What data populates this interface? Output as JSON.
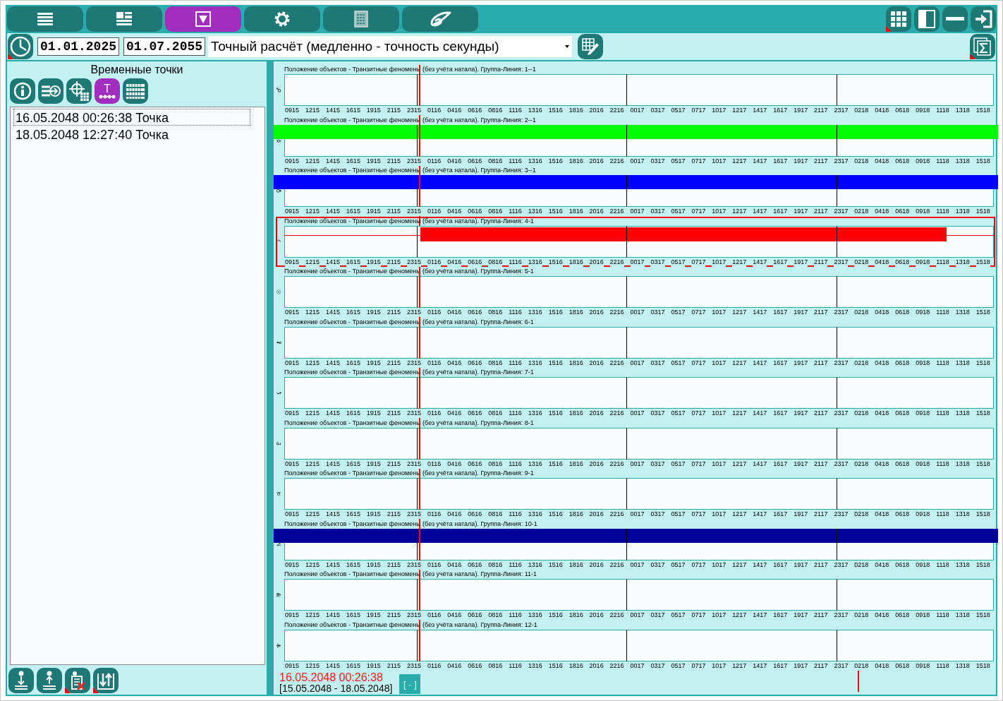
{
  "toolbar": {
    "tabs": [
      {
        "selected": false
      },
      {
        "selected": false
      },
      {
        "selected": true
      },
      {
        "selected": false
      },
      {
        "selected": false
      },
      {
        "selected": false
      }
    ],
    "window_buttons": [
      {
        "marked": true
      },
      {
        "marked": false
      },
      {
        "marked": false
      },
      {
        "marked": false
      }
    ]
  },
  "range_bar": {
    "clock_marked": true,
    "date_from": "01.01.2025",
    "date_to": "01.07.2055",
    "mode": "Точный расчёт (медленно - точность секунды)",
    "sum_marked": true
  },
  "time_points": {
    "title": "Временные точки",
    "tools": [
      {
        "selected": false
      },
      {
        "selected": false
      },
      {
        "selected": false
      },
      {
        "selected": true,
        "label": "T"
      },
      {
        "selected": false
      }
    ],
    "items": [
      {
        "text": "16.05.2048 00:26:38 Точка",
        "selected": true
      },
      {
        "text": "18.05.2048 12:27:40 Точка",
        "selected": false
      }
    ],
    "bottom_tools": [
      {
        "marked": false
      },
      {
        "marked": false
      },
      {
        "marked": true
      },
      {
        "marked": true
      }
    ]
  },
  "tracks": [
    {
      "title": "Положение объектов - Транзитные феномены (без учёта натала). Группа-Линия: 1--1",
      "symbol": "♂",
      "selected": false,
      "ticks": [
        "0915",
        "1215",
        "1415",
        "1615",
        "1915",
        "2115",
        "2315",
        "0116",
        "0416",
        "0616",
        "0816",
        "1116",
        "1316",
        "1516",
        "1816",
        "2016",
        "2216",
        "0017",
        "0317",
        "0517",
        "0717",
        "1017",
        "1217",
        "1417",
        "1617",
        "1917",
        "2117",
        "2317",
        "0218",
        "0418",
        "0618",
        "0918",
        "1118",
        "1318",
        "1518"
      ]
    },
    {
      "title": "Положение объектов - Транзитные феномены (без учёта натала). Группа-Линия: 2--1",
      "symbol": "☿",
      "selected": false,
      "band": {
        "color": "#00ff00",
        "kind": "full"
      },
      "ticks": [
        "0915",
        "1215",
        "1415",
        "1615",
        "1915",
        "2115",
        "2315",
        "0116",
        "0416",
        "0616",
        "0816",
        "1116",
        "1316",
        "1516",
        "1816",
        "2016",
        "2216",
        "0017",
        "0317",
        "0517",
        "0717",
        "1017",
        "1217",
        "1417",
        "1617",
        "1917",
        "2117",
        "2317",
        "0218",
        "0418",
        "0618",
        "0918",
        "1118",
        "1318",
        "1518"
      ]
    },
    {
      "title": "Положение объектов - Транзитные феномены (без учёта натала). Группа-Линия: 3--1",
      "symbol": "♀",
      "selected": false,
      "band": {
        "color": "#0000ff",
        "kind": "full"
      },
      "ticks": [
        "0915",
        "1215",
        "1415",
        "1615",
        "1915",
        "2115",
        "2315",
        "0116",
        "0416",
        "0616",
        "0816",
        "1116",
        "1316",
        "1516",
        "1816",
        "2016",
        "2216",
        "0017",
        "0317",
        "0517",
        "0717",
        "1017",
        "1217",
        "1417",
        "1617",
        "1917",
        "2117",
        "2317",
        "0218",
        "0418",
        "0618",
        "0918",
        "1118",
        "1318",
        "1518"
      ]
    },
    {
      "title": "Положение объектов - Транзитные феномены (без учёта натала). Группа-Линия: 4-1",
      "symbol": "☽",
      "selected": true,
      "band": {
        "color": "#ff0000",
        "kind": "partial"
      },
      "ticks": [
        "0915",
        "1215",
        "1415",
        "1615",
        "1915",
        "2115",
        "2315",
        "0116",
        "0416",
        "0616",
        "0816",
        "1116",
        "1316",
        "1516",
        "1816",
        "2016",
        "2216",
        "0017",
        "0317",
        "0517",
        "0717",
        "1017",
        "1217",
        "1417",
        "1617",
        "1917",
        "2117",
        "2317",
        "0218",
        "0418",
        "0618",
        "0918",
        "1118",
        "1318",
        "1518"
      ]
    },
    {
      "title": "Положение объектов - Транзитные феномены (без учёта натала). Группа-Линия: 5-1",
      "symbol": "☉",
      "selected": false,
      "ticks": [
        "0915",
        "1215",
        "1415",
        "1615",
        "1915",
        "2115",
        "2315",
        "0116",
        "0416",
        "0616",
        "0816",
        "1116",
        "1316",
        "1516",
        "1816",
        "2016",
        "2216",
        "0017",
        "0317",
        "0517",
        "0717",
        "1017",
        "1217",
        "1417",
        "1617",
        "1917",
        "2117",
        "2317",
        "0218",
        "0418",
        "0618",
        "0918",
        "1118",
        "1318",
        "1518"
      ]
    },
    {
      "title": "Положение объектов - Транзитные феномены (без учёта натала). Группа-Линия: 6-1",
      "symbol": "⚷",
      "selected": false,
      "ticks": [
        "0915",
        "1215",
        "1415",
        "1615",
        "1915",
        "2115",
        "2315",
        "0116",
        "0416",
        "0616",
        "0816",
        "1116",
        "1316",
        "1516",
        "1816",
        "2016",
        "2216",
        "0017",
        "0317",
        "0517",
        "0717",
        "1017",
        "1217",
        "1417",
        "1617",
        "1917",
        "2117",
        "2317",
        "0218",
        "0418",
        "0618",
        "0918",
        "1118",
        "1318",
        "1518"
      ]
    },
    {
      "title": "Положение объектов - Транзитные феномены (без учёта натала). Группа-Линия: 7-1",
      "symbol": "⚸",
      "selected": false,
      "ticks": [
        "0915",
        "1215",
        "1415",
        "1615",
        "1915",
        "2115",
        "2315",
        "0116",
        "0416",
        "0616",
        "0816",
        "1116",
        "1316",
        "1516",
        "1816",
        "2016",
        "2216",
        "0017",
        "0317",
        "0517",
        "0717",
        "1017",
        "1217",
        "1417",
        "1617",
        "1917",
        "2117",
        "2317",
        "0218",
        "0418",
        "0618",
        "0918",
        "1118",
        "1318",
        "1518"
      ]
    },
    {
      "title": "Положение объектов - Транзитные феномены (без учёта натала). Группа-Линия: 8-1",
      "symbol": "♇",
      "selected": false,
      "ticks": [
        "0915",
        "1215",
        "1415",
        "1615",
        "1915",
        "2115",
        "2315",
        "0116",
        "0416",
        "0616",
        "0816",
        "1116",
        "1316",
        "1516",
        "1816",
        "2016",
        "2216",
        "0017",
        "0317",
        "0517",
        "0717",
        "1017",
        "1217",
        "1417",
        "1617",
        "1917",
        "2117",
        "2317",
        "0218",
        "0418",
        "0618",
        "0918",
        "1118",
        "1318",
        "1518"
      ]
    },
    {
      "title": "Положение объектов - Транзитные феномены (без учёта натала). Группа-Линия: 9-1",
      "symbol": "♃",
      "selected": false,
      "ticks": [
        "0915",
        "1215",
        "1415",
        "1615",
        "1915",
        "2115",
        "2315",
        "0116",
        "0416",
        "0616",
        "0816",
        "1116",
        "1316",
        "1516",
        "1816",
        "2016",
        "2216",
        "0017",
        "0317",
        "0517",
        "0717",
        "1017",
        "1217",
        "1417",
        "1617",
        "1917",
        "2117",
        "2317",
        "0218",
        "0418",
        "0618",
        "0918",
        "1118",
        "1318",
        "1518"
      ]
    },
    {
      "title": "Положение объектов - Транзитные феномены (без учёта натала). Группа-Линия: 10-1",
      "symbol": "♄",
      "selected": false,
      "band": {
        "color": "#000099",
        "kind": "full"
      },
      "ticks": [
        "0915",
        "1215",
        "1415",
        "1615",
        "1915",
        "2115",
        "2315",
        "0116",
        "0416",
        "0616",
        "0816",
        "1116",
        "1316",
        "1516",
        "1816",
        "2016",
        "2216",
        "0017",
        "0317",
        "0517",
        "0717",
        "1017",
        "1217",
        "1417",
        "1617",
        "1917",
        "2117",
        "2317",
        "0218",
        "0418",
        "0618",
        "0918",
        "1118",
        "1318",
        "1518"
      ]
    },
    {
      "title": "Положение объектов - Транзитные феномены (без учёта натала). Группа-Линия: 11-1",
      "symbol": "♅",
      "selected": false,
      "ticks": [
        "0915",
        "1215",
        "1415",
        "1615",
        "1915",
        "2115",
        "2315",
        "0116",
        "0416",
        "0616",
        "0816",
        "1116",
        "1316",
        "1516",
        "1816",
        "2016",
        "2216",
        "0017",
        "0317",
        "0517",
        "0717",
        "1017",
        "1217",
        "1417",
        "1617",
        "1917",
        "2117",
        "2317",
        "0218",
        "0418",
        "0618",
        "0918",
        "1118",
        "1318",
        "1518"
      ]
    },
    {
      "title": "Положение объектов - Транзитные феномены (без учёта натала). Группа-Линия: 12-1",
      "symbol": "♆",
      "selected": false,
      "ticks": [
        "0915",
        "1215",
        "1415",
        "1615",
        "1915",
        "2115",
        "2315",
        "0116",
        "0416",
        "0616",
        "0816",
        "1116",
        "1316",
        "1516",
        "1816",
        "2016",
        "2216",
        "0017",
        "0317",
        "0517",
        "0717",
        "1017",
        "1217",
        "1417",
        "1617",
        "1917",
        "2117",
        "2317",
        "0218",
        "0418",
        "0618",
        "0918",
        "1118",
        "1318",
        "1518"
      ]
    }
  ],
  "footer": {
    "cursor_time": "16.05.2048 00:26:38",
    "range": "[15.05.2048 - 18.05.2048]",
    "collapse_button": "[ - ]"
  }
}
